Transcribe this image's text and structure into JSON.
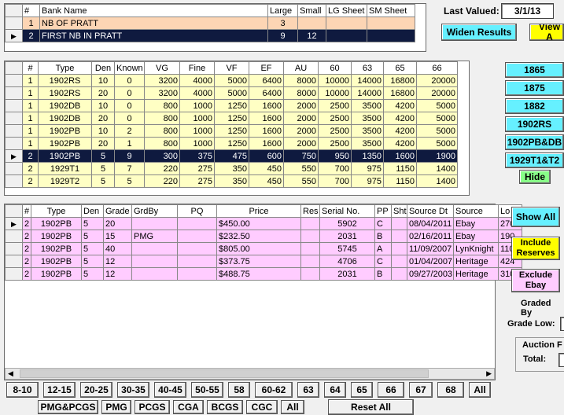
{
  "banks": {
    "headers": [
      "#",
      "Bank Name",
      "Large",
      "Small",
      "LG Sheet",
      "SM Sheet"
    ],
    "rows": [
      {
        "num": "1",
        "name": "NB OF PRATT",
        "large": "3",
        "small": "",
        "lg_sheet": "",
        "sm_sheet": ""
      },
      {
        "num": "2",
        "name": "FIRST NB IN PRATT",
        "large": "9",
        "small": "12",
        "lg_sheet": "",
        "sm_sheet": ""
      }
    ]
  },
  "last_valued": {
    "label": "Last Valued:",
    "value": "3/1/13"
  },
  "top_buttons": {
    "widen": "Widen Results",
    "view": "View A"
  },
  "values": {
    "headers": [
      "#",
      "Type",
      "Den",
      "Known",
      "VG",
      "Fine",
      "VF",
      "EF",
      "AU",
      "60",
      "63",
      "65",
      "66"
    ],
    "rows": [
      [
        "1",
        "1902RS",
        "10",
        "0",
        "3200",
        "4000",
        "5000",
        "6400",
        "8000",
        "10000",
        "14000",
        "16800",
        "20000"
      ],
      [
        "1",
        "1902RS",
        "20",
        "0",
        "3200",
        "4000",
        "5000",
        "6400",
        "8000",
        "10000",
        "14000",
        "16800",
        "20000"
      ],
      [
        "1",
        "1902DB",
        "10",
        "0",
        "800",
        "1000",
        "1250",
        "1600",
        "2000",
        "2500",
        "3500",
        "4200",
        "5000"
      ],
      [
        "1",
        "1902DB",
        "20",
        "0",
        "800",
        "1000",
        "1250",
        "1600",
        "2000",
        "2500",
        "3500",
        "4200",
        "5000"
      ],
      [
        "1",
        "1902PB",
        "10",
        "2",
        "800",
        "1000",
        "1250",
        "1600",
        "2000",
        "2500",
        "3500",
        "4200",
        "5000"
      ],
      [
        "1",
        "1902PB",
        "20",
        "1",
        "800",
        "1000",
        "1250",
        "1600",
        "2000",
        "2500",
        "3500",
        "4200",
        "5000"
      ],
      [
        "2",
        "1902PB",
        "5",
        "9",
        "300",
        "375",
        "475",
        "600",
        "750",
        "950",
        "1350",
        "1600",
        "1900"
      ],
      [
        "2",
        "1929T1",
        "5",
        "7",
        "220",
        "275",
        "350",
        "450",
        "550",
        "700",
        "975",
        "1150",
        "1400"
      ],
      [
        "2",
        "1929T2",
        "5",
        "5",
        "220",
        "275",
        "350",
        "450",
        "550",
        "700",
        "975",
        "1150",
        "1400"
      ]
    ]
  },
  "type_buttons": [
    "1865",
    "1875",
    "1882",
    "1902RS",
    "1902PB&DB",
    "1929T1&T2"
  ],
  "hide_label": "Hide",
  "sales": {
    "headers": [
      "#",
      "Type",
      "Den",
      "Grade",
      "GrdBy",
      "PQ",
      "Price",
      "Res",
      "Serial No.",
      "PP",
      "Sht",
      "Source Dt",
      "Source",
      "Lo"
    ],
    "rows": [
      [
        "2",
        "1902PB",
        "5",
        "20",
        "",
        "",
        "$450.00",
        "",
        "5902",
        "C",
        "",
        "08/04/2011",
        "Ebay",
        "270"
      ],
      [
        "2",
        "1902PB",
        "5",
        "15",
        "PMG",
        "",
        "$232.50",
        "",
        "2031",
        "B",
        "",
        "02/16/2011",
        "Ebay",
        "190"
      ],
      [
        "2",
        "1902PB",
        "5",
        "40",
        "",
        "",
        "$805.00",
        "",
        "5745",
        "A",
        "",
        "11/09/2007",
        "LynKnight",
        "110"
      ],
      [
        "2",
        "1902PB",
        "5",
        "12",
        "",
        "",
        "$373.75",
        "",
        "4706",
        "C",
        "",
        "01/04/2007",
        "Heritage",
        "424"
      ],
      [
        "2",
        "1902PB",
        "5",
        "12",
        "",
        "",
        "$488.75",
        "",
        "2031",
        "B",
        "",
        "09/27/2003",
        "Heritage",
        "310"
      ]
    ]
  },
  "side_buttons": {
    "show_all": "Show All",
    "include_reserves": "Include Reserves",
    "exclude_ebay": "Exclude Ebay"
  },
  "side_labels": {
    "graded_by": "Graded By",
    "grade_low": "Grade Low:",
    "auction": "Auction F",
    "total": "Total:"
  },
  "grade_buttons": [
    "8-10",
    "12-15",
    "20-25",
    "30-35",
    "40-45",
    "50-55",
    "58",
    "60-62",
    "63",
    "64",
    "65",
    "66",
    "67",
    "68",
    "All"
  ],
  "grader_buttons": [
    "PMG&PCGS",
    "PMG",
    "PCGS",
    "CGA",
    "BCGS",
    "CGC",
    "All"
  ],
  "reset_label": "Reset All"
}
